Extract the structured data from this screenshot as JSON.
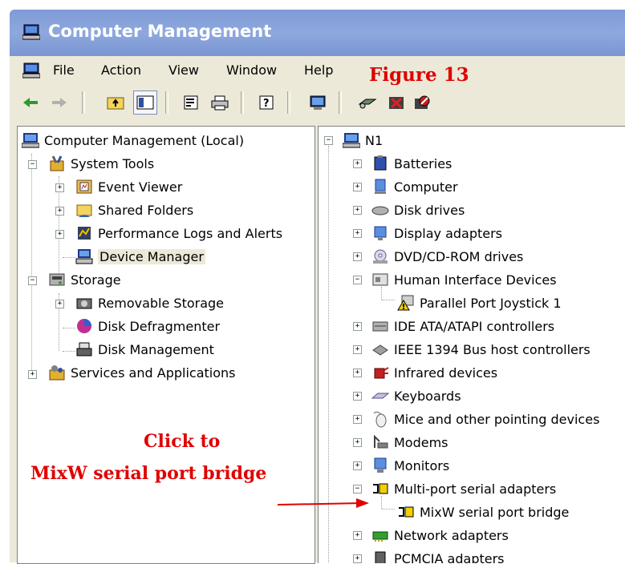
{
  "window": {
    "title": "Computer Management",
    "title_bar_color": "#7f9ad6",
    "menu": [
      "File",
      "Action",
      "View",
      "Window",
      "Help"
    ]
  },
  "toolbar": {
    "buttons": [
      "back-icon",
      "forward-icon",
      "up-folder-icon",
      "show-hide-tree-icon",
      "properties-icon",
      "print-icon",
      "help-icon",
      "console-icon",
      "scan-hardware-icon",
      "uninstall-icon",
      "disable-icon"
    ]
  },
  "annotations": {
    "figure": "Figure 13",
    "click_line1": "Click to",
    "click_line2": "MixW serial port bridge",
    "color": "#e00000"
  },
  "left_tree": {
    "root": "Computer Management (Local)",
    "system_tools": "System Tools",
    "event_viewer": "Event Viewer",
    "shared_folders": "Shared Folders",
    "perf_logs": "Performance Logs and Alerts",
    "device_manager": "Device Manager",
    "storage": "Storage",
    "removable_storage": "Removable Storage",
    "disk_defrag": "Disk Defragmenter",
    "disk_management": "Disk Management",
    "services_apps": "Services and Applications"
  },
  "right_tree": {
    "root": "N1",
    "items": [
      "Batteries",
      "Computer",
      "Disk drives",
      "Display adapters",
      "DVD/CD-ROM drives",
      "Human Interface Devices",
      "Parallel Port Joystick 1",
      "IDE ATA/ATAPI controllers",
      "IEEE 1394 Bus host controllers",
      "Infrared devices",
      "Keyboards",
      "Mice and other pointing devices",
      "Modems",
      "Monitors",
      "Multi-port serial adapters",
      "MixW serial port bridge",
      "Network adapters",
      "PCMCIA adapters"
    ]
  }
}
